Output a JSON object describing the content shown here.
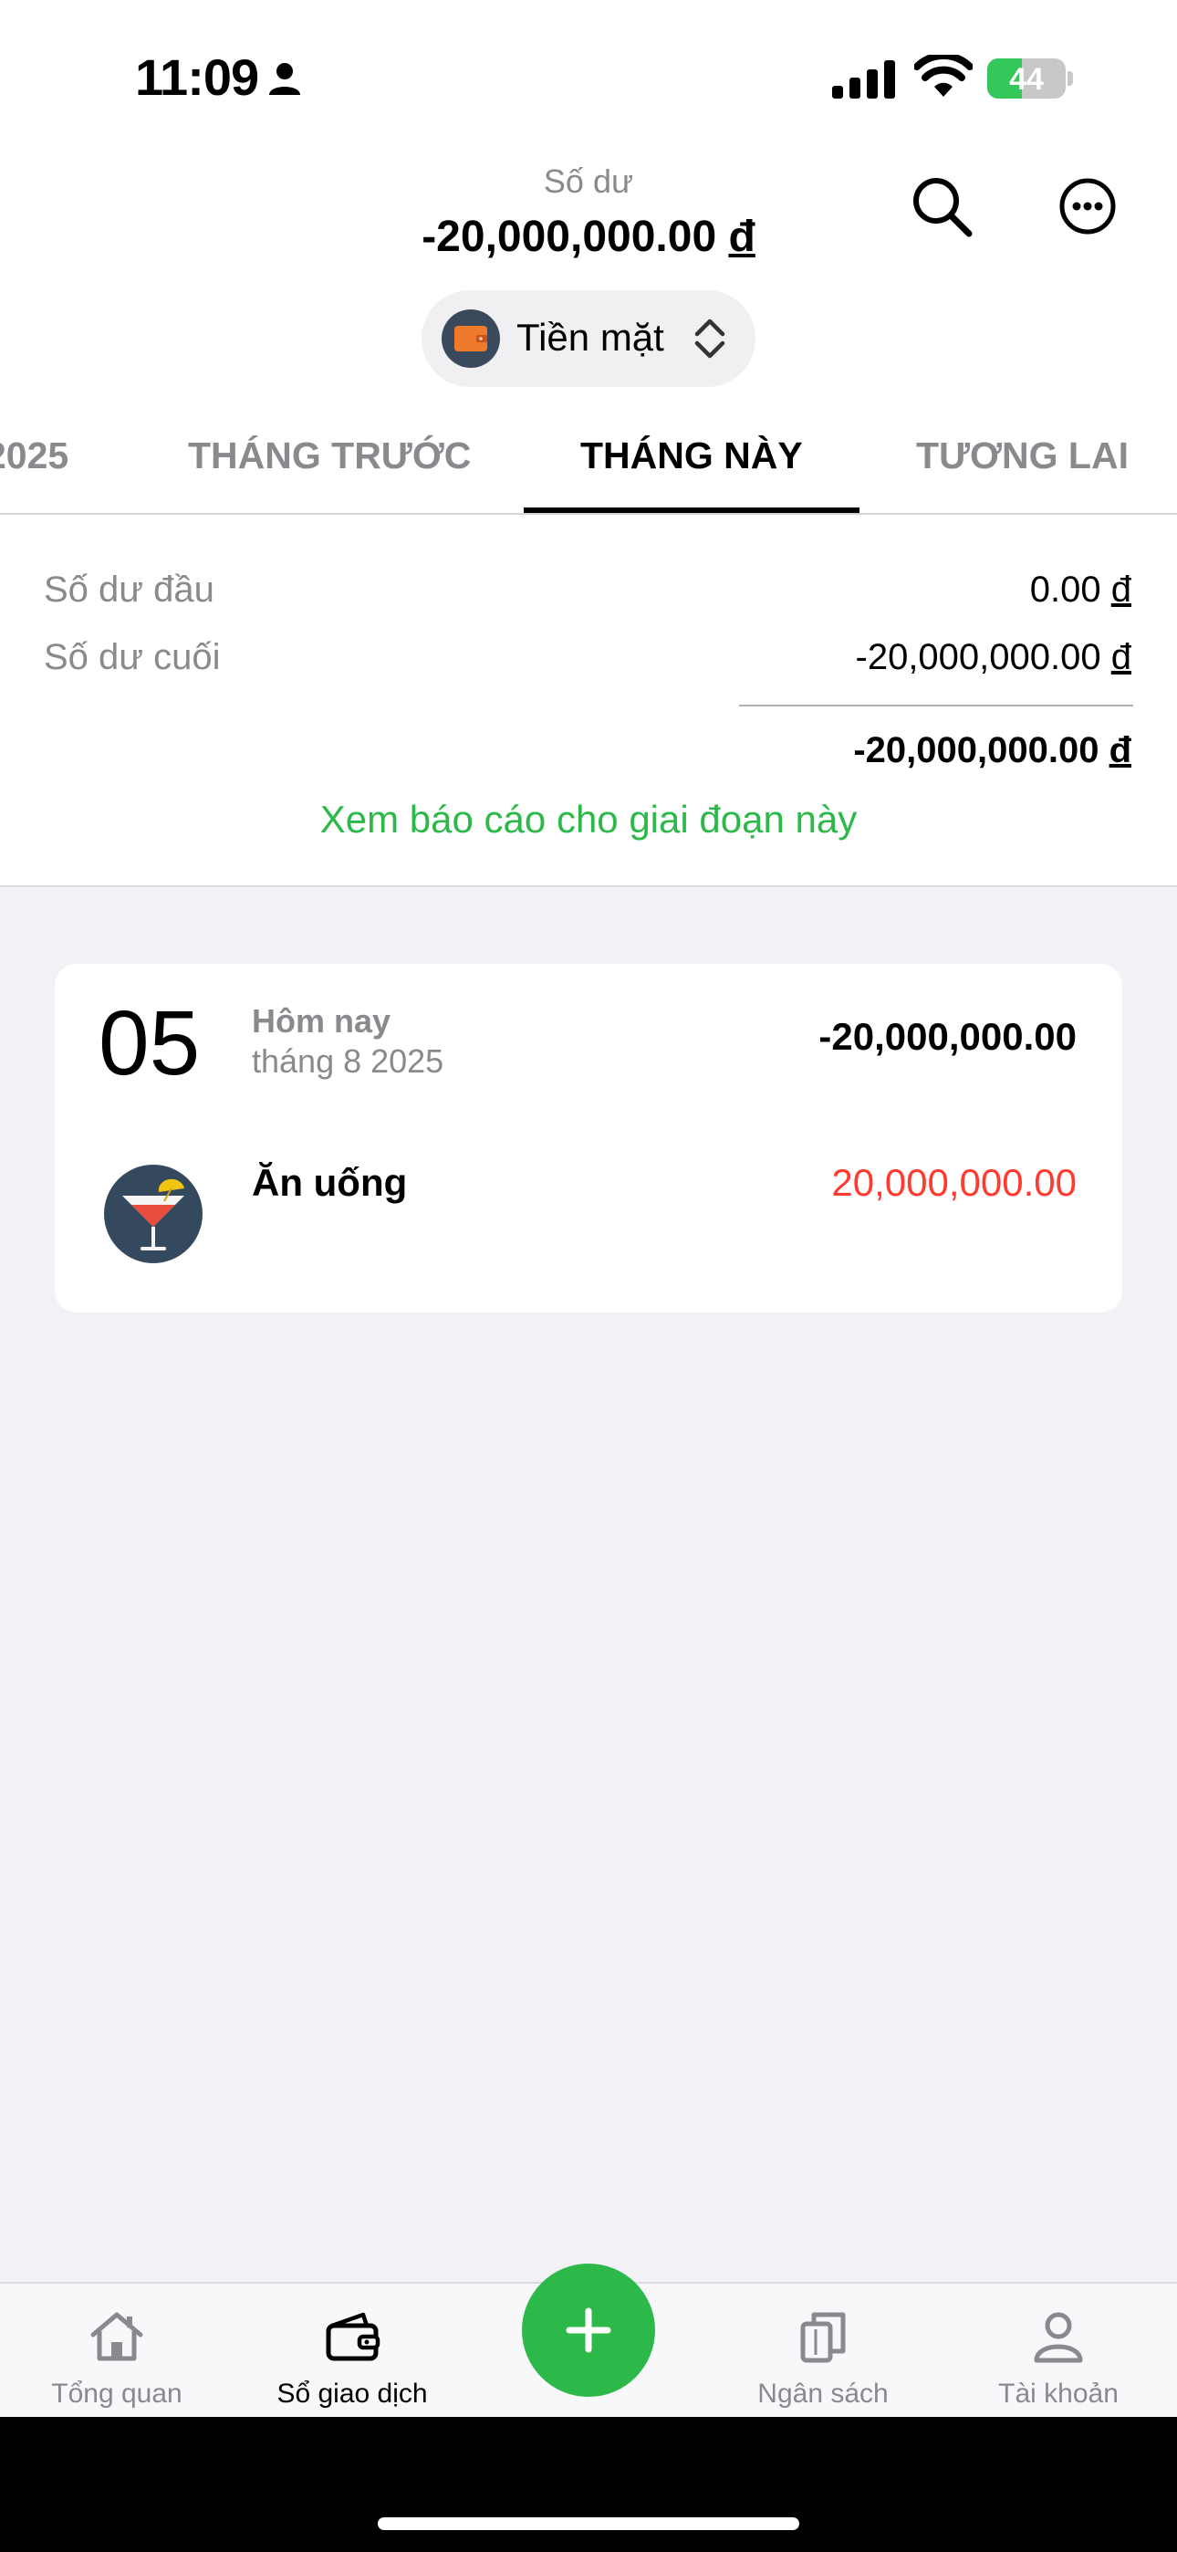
{
  "status_bar": {
    "time": "11:09",
    "battery": "44",
    "battery_level": 0.44
  },
  "header": {
    "balance_caption": "Số dư",
    "balance_amount": "-20,000,000.00",
    "currency": "đ",
    "wallet_name": "Tiền mặt"
  },
  "tabs": [
    {
      "label": "2025"
    },
    {
      "label": "THÁNG TRƯỚC"
    },
    {
      "label": "THÁNG NÀY",
      "active": true
    },
    {
      "label": "TƯƠNG LAI"
    }
  ],
  "summary": {
    "opening_label": "Số dư đầu",
    "opening_value": "0.00",
    "closing_label": "Số dư cuối",
    "closing_value": "-20,000,000.00",
    "total_value": "-20,000,000.00",
    "currency": "đ",
    "report_link": "Xem báo cáo cho giai đoạn này"
  },
  "transactions": [
    {
      "day": "05",
      "day_label": "Hôm nay",
      "month_label": "tháng 8 2025",
      "day_total": "-20,000,000.00",
      "items": [
        {
          "category": "Ăn uống",
          "amount": "20,000,000.00",
          "icon": "cocktail-icon"
        }
      ]
    }
  ],
  "bottom_nav": [
    {
      "label": "Tổng quan",
      "icon": "home-icon"
    },
    {
      "label": "Sổ giao dịch",
      "icon": "wallet-icon",
      "active": true
    },
    {
      "label": "Ngân sách",
      "icon": "budget-icon"
    },
    {
      "label": "Tài khoản",
      "icon": "account-icon"
    }
  ],
  "colors": {
    "accent": "#2db84a",
    "expense": "#ff3b30",
    "muted": "#8a8a8e",
    "background": "#f1f1f6"
  }
}
